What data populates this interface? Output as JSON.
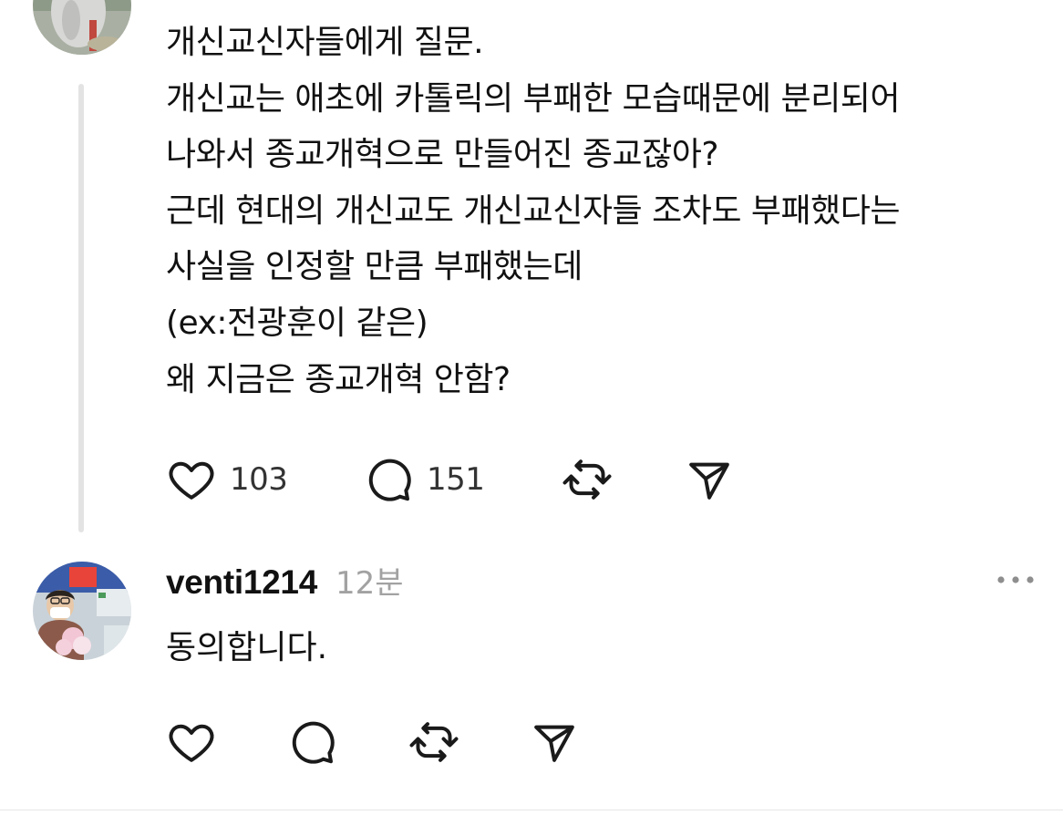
{
  "post": {
    "lines": [
      "개신교신자들에게 질문.",
      "개신교는 애초에 카톨릭의 부패한 모습때문에 분리되어",
      "나와서 종교개혁으로 만들어진 종교잖아?",
      "근데 현대의 개신교도 개신교신자들 조차도 부패했다는",
      "사실을 인정할 만큼 부패했는데",
      "(ex:전광훈이 같은)",
      "왜 지금은 종교개혁 안함?"
    ],
    "likes": "103",
    "comments": "151"
  },
  "reply": {
    "username": "venti1214",
    "time": "12분",
    "text": "동의합니다."
  },
  "icons": {
    "like": "heart-icon",
    "comment": "comment-bubble-icon",
    "repost": "repost-icon",
    "share": "share-send-icon",
    "more": "more-horizontal-icon"
  },
  "colors": {
    "text": "#111111",
    "secondary": "#a2a2a2",
    "icon": "#1a1a1a",
    "thread_line": "#e3e3e3"
  }
}
